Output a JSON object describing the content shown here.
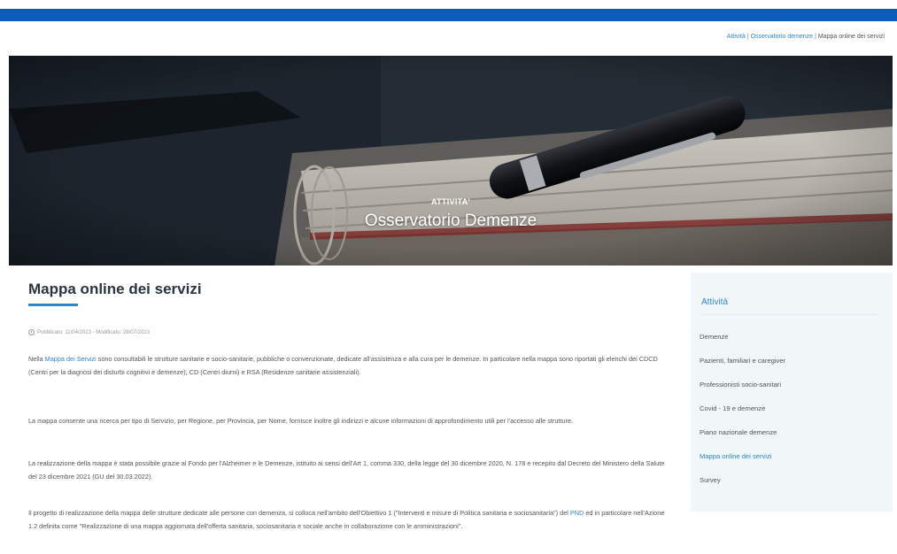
{
  "breadcrumb": {
    "item1": "Attività",
    "separator": "|",
    "item2": "Osservatorio demenze",
    "current": "Mappa online dei servizi"
  },
  "hero": {
    "kicker": "ATTIVITA'",
    "title": "Osservatorio Demenze"
  },
  "page": {
    "title": "Mappa online dei servizi",
    "meta": "Pubblicato: 11/04/2023 - Modificato: 28/07/2023",
    "paragraphs": {
      "p1_before": "Nella ",
      "p1_link": "Mappa dei Servizi",
      "p1_after": " sono consultabili le strutture sanitarie e socio-sanitarie, pubbliche o convenzionate, dedicate all'assistenza e alla cura per le demenze. In particolare nella mappa sono riportati gli elenchi dei CDCD (Centri per la diagnosi dei disturbi cognitivi e demenze), CD (Centri diurni) e RSA (Residenze sanitarie assistenziali).",
      "p2": "La mappa consente una ricerca per tipo di Servizio, per Regione, per Provincia, per Nome, fornisce inoltre gli indirizzi e alcune informazioni di approfondimento utili per l'accesso alle strutture.",
      "p3": "La realizzazione della mappa è stata possibile grazie al Fondo per l'Alzheimer e le Demenze, istituito ai sensi dell'Art 1, comma 330, della legge del 30 dicembre 2020, N. 178 e recepito dal Decreto del Ministero della Salute del 23 dicembre 2021 (GU del 30.03.2022).",
      "p4_before": "Il progetto di realizzazione della mappa delle strutture dedicate alle persone con demenza, si colloca nell'ambito dell'Obiettivo 1 (\"Interventi e misure di Politica sanitaria e sociosanitaria\") del ",
      "p4_link": "PND",
      "p4_after": " ed in particolare nell'Azione 1.2 definita come \"Realizzazione di una mappa aggiornata dell'offerta sanitaria, sociosanitaria e sociale anche in collaborazione con le amministrazioni\"."
    }
  },
  "sidebar": {
    "title": "Attività",
    "items": [
      "Demenze",
      "Pazienti, familiari e caregiver",
      "Professionisti socio-sanitari",
      "Covid - 19 e demenze",
      "Piano nazionale demenze",
      "Mappa online dei servizi",
      "Survey"
    ],
    "active_index": 5
  },
  "colors": {
    "topbar": "#0a5cb8",
    "accent": "#2f86c9",
    "sidebar_bg": "#f1f6f9"
  }
}
